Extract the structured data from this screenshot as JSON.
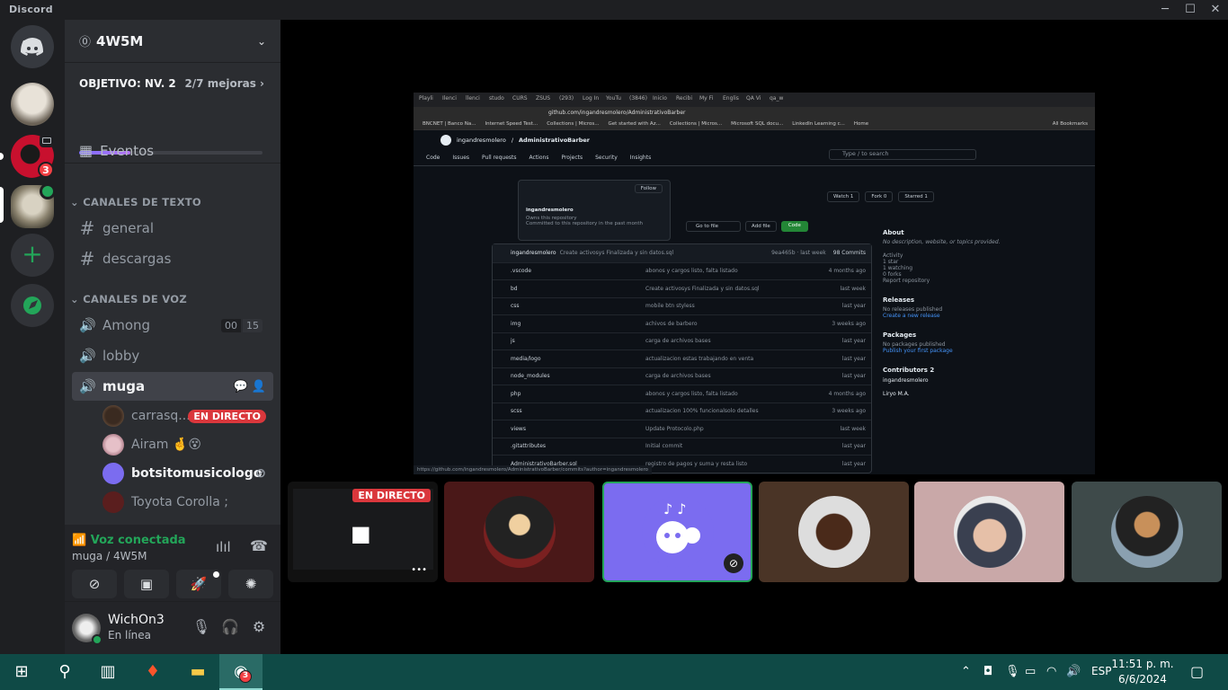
{
  "app": {
    "title": "Discord"
  },
  "servers": [
    {
      "name": "discord-home",
      "badge": ""
    },
    {
      "name": "dog-server",
      "badge": ""
    },
    {
      "name": "red-server",
      "badge": "3"
    },
    {
      "name": "cat-server",
      "badge": ""
    }
  ],
  "guild": {
    "name": "4W5M",
    "boost_label": "OBJETIVO: NV. 2",
    "boost_count": "2/7 mejoras",
    "boost_progress": 0.28,
    "events": "Eventos"
  },
  "text_category": "CANALES DE TEXTO",
  "text_channels": [
    "general",
    "descargas"
  ],
  "voice_category": "CANALES DE VOZ",
  "voice_channels": [
    {
      "name": "Among",
      "c1": "00",
      "c2": "15"
    },
    {
      "name": "lobby"
    },
    {
      "name": "muga"
    }
  ],
  "voice_users": [
    {
      "name": "carrasq...",
      "live": "EN DIRECTO"
    },
    {
      "name": "Airam 🤞😵"
    },
    {
      "name": "botsitomusicologo"
    },
    {
      "name": "Toyota Corolla ;"
    }
  ],
  "voice_panel": {
    "status": "Voz conectada",
    "location": "muga / 4W5M"
  },
  "user": {
    "name": "WichOn3",
    "status": "En línea"
  },
  "stream": {
    "tabs": [
      "Playli",
      "Ilenci",
      "llenci",
      "studo",
      "CURS",
      "ZSUS",
      "(293)",
      "Log In",
      "YouTu",
      "(3846)",
      "Inicio",
      "Recibi",
      "My Fi",
      "Englis",
      "QA Vi",
      "qa_w"
    ],
    "url": "github.com/ingandresmolero/AdministrativoBarber",
    "bookmarks": [
      "BNCNET | Banco Na...",
      "Internet Speed Test...",
      "Collections | Micros...",
      "Get started with Az...",
      "Collections | Micros...",
      "Microsoft SQL docu...",
      "LinkedIn Learning c...",
      "Home",
      "All Bookmarks"
    ],
    "repo_owner": "ingandresmolero",
    "repo_name": "AdministrativoBarber",
    "search": "Type / to search",
    "nav": [
      "Code",
      "Issues",
      "Pull requests",
      "Actions",
      "Projects",
      "Security",
      "Insights"
    ],
    "popover": {
      "follow": "Follow",
      "user": "ingandresmolero",
      "l1": "Owns this repository",
      "l2": "Committed to this repository in the past month"
    },
    "buttons": {
      "watch": "Watch 1",
      "fork": "Fork 0",
      "starred": "Starred 1",
      "goto": "Go to file",
      "add": "Add file",
      "code": "Code"
    },
    "commit": {
      "user": "ingandresmolero",
      "msg": "Create activosys Finalizada y sin datos.sql",
      "hash": "9ea465b · last week",
      "count": "98 Commits"
    },
    "files": [
      {
        "name": ".vscode",
        "msg": "abonos y cargos listo, falta listado",
        "time": "4 months ago"
      },
      {
        "name": "bd",
        "msg": "Create activosys Finalizada y sin datos.sql",
        "time": "last week"
      },
      {
        "name": "css",
        "msg": "mobile btn styless",
        "time": "last year"
      },
      {
        "name": "img",
        "msg": "achivos de barbero",
        "time": "3 weeks ago"
      },
      {
        "name": "js",
        "msg": "carga de archivos bases",
        "time": "last year"
      },
      {
        "name": "media/logo",
        "msg": "actualizacion estas trabajando en venta",
        "time": "last year"
      },
      {
        "name": "node_modules",
        "msg": "carga de archivos bases",
        "time": "last year"
      },
      {
        "name": "php",
        "msg": "abonos y cargos listo, falta listado",
        "time": "4 months ago"
      },
      {
        "name": "scss",
        "msg": "actualizacion 100% funcionalsolo detalles",
        "time": "3 weeks ago"
      },
      {
        "name": "views",
        "msg": "Update Protocolo.php",
        "time": "last week"
      },
      {
        "name": ".gitattributes",
        "msg": "Initial commit",
        "time": "last year"
      },
      {
        "name": "AdministrativoBarber.sql",
        "msg": "registro de pagos y suma y resta listo",
        "time": "last year"
      }
    ],
    "about": {
      "title": "About",
      "desc": "No description, website, or topics provided.",
      "activity": "Activity",
      "stars": "1 star",
      "watching": "1 watching",
      "forks": "0 forks",
      "report": "Report repository",
      "releases": "Releases",
      "no_releases": "No releases published",
      "create_release": "Create a new release",
      "packages": "Packages",
      "no_packages": "No packages published",
      "publish": "Publish your first package",
      "contributors": "Contributors",
      "contrib_count": "2",
      "c1": "ingandresmolero",
      "c2": "Liryo M.A."
    },
    "status_url": "https://github.com/ingandresmolero/AdministrativoBarber/commits?author=ingandresmolero"
  },
  "tiles": {
    "live": "EN DIRECTO",
    "more": "•••"
  },
  "taskbar": {
    "lang": "ESP",
    "time": "11:51 p. m.",
    "date": "6/6/2024",
    "app_badge": "3"
  },
  "colors": {
    "accent": "#5865f2",
    "green": "#23a559",
    "red": "#da373c",
    "taskbar": "#0f4a46"
  }
}
